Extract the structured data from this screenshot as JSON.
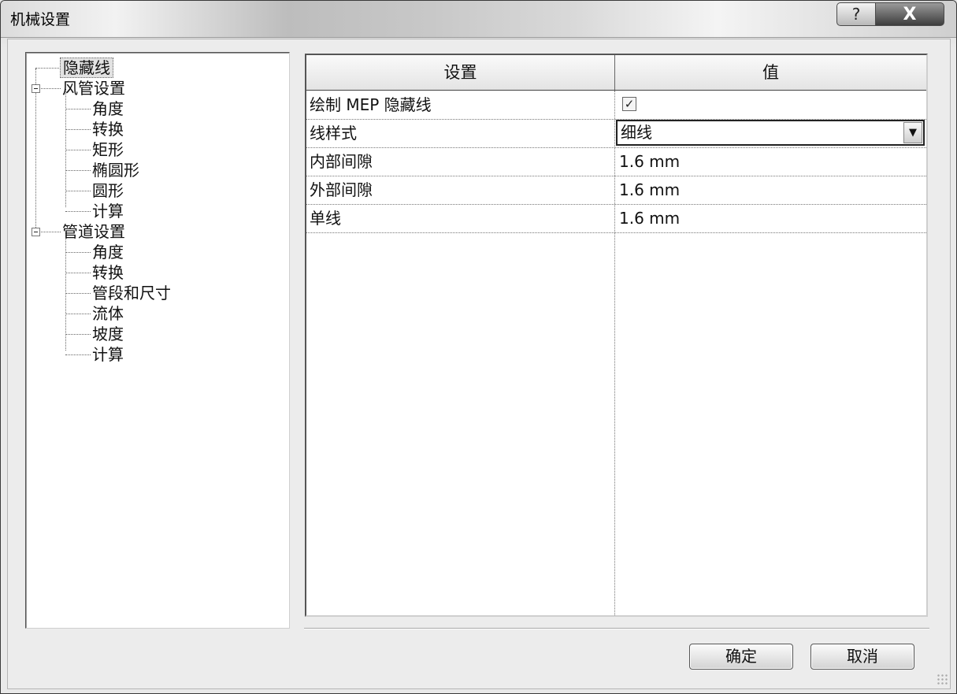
{
  "window": {
    "title": "机械设置",
    "help_glyph": "?",
    "close_glyph": "X"
  },
  "tree": {
    "items": [
      {
        "label": "隐藏线",
        "level": 0,
        "selected": true
      },
      {
        "label": "风管设置",
        "level": 0,
        "expander": "⊟"
      },
      {
        "label": "角度",
        "level": 1
      },
      {
        "label": "转换",
        "level": 1
      },
      {
        "label": "矩形",
        "level": 1
      },
      {
        "label": "椭圆形",
        "level": 1
      },
      {
        "label": "圆形",
        "level": 1
      },
      {
        "label": "计算",
        "level": 1
      },
      {
        "label": "管道设置",
        "level": 0,
        "expander": "⊟"
      },
      {
        "label": "角度",
        "level": 1
      },
      {
        "label": "转换",
        "level": 1
      },
      {
        "label": "管段和尺寸",
        "level": 1
      },
      {
        "label": "流体",
        "level": 1
      },
      {
        "label": "坡度",
        "level": 1
      },
      {
        "label": "计算",
        "level": 1
      }
    ]
  },
  "grid": {
    "headers": {
      "setting": "设置",
      "value": "值"
    },
    "rows": [
      {
        "setting": "绘制 MEP 隐藏线",
        "value": "",
        "type": "checkbox",
        "checked": true,
        "check_glyph": "✓"
      },
      {
        "setting": "线样式",
        "value": "细线",
        "type": "dropdown",
        "arrow_glyph": "▼"
      },
      {
        "setting": "内部间隙",
        "value": "1.6 mm",
        "type": "text"
      },
      {
        "setting": "外部间隙",
        "value": "1.6 mm",
        "type": "text"
      },
      {
        "setting": "单线",
        "value": "1.6 mm",
        "type": "text"
      }
    ]
  },
  "buttons": {
    "ok": "确定",
    "cancel": "取消"
  }
}
